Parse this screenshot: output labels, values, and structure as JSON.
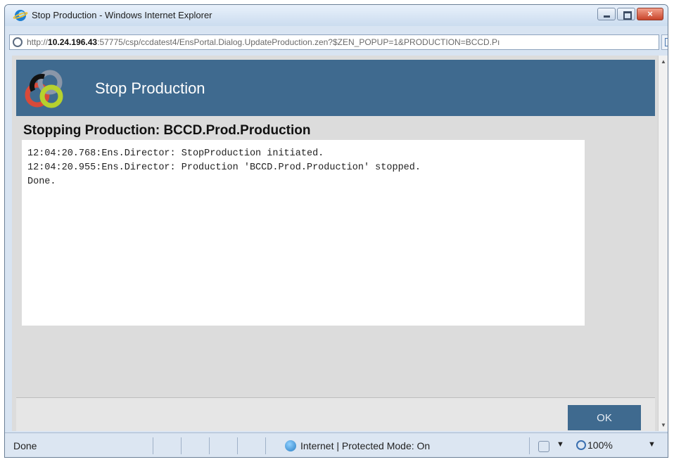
{
  "window": {
    "title": "Stop Production - Windows Internet Explorer",
    "url_prefix": "http://",
    "url_host": "10.24.196.43",
    "url_rest": ":57775/csp/ccdatest4/EnsPortal.Dialog.UpdateProduction.zen?$ZEN_POPUP=1&PRODUCTION=BCCD.Pı",
    "close_label": "×"
  },
  "dialog": {
    "banner_title": "Stop Production",
    "heading": "Stopping Production:  BCCD.Prod.Production",
    "log_lines": [
      "12:04:20.768:Ens.Director: StopProduction initiated.",
      "12:04:20.955:Ens.Director: Production 'BCCD.Prod.Production' stopped.",
      "Done."
    ],
    "ok_label": "OK"
  },
  "statusbar": {
    "status": "Done",
    "zone": "Internet | Protected Mode: On",
    "zoom": "100%",
    "dropdown_glyph": "▼"
  },
  "scroll": {
    "up": "▲",
    "down": "▼"
  },
  "colors": {
    "banner": "#3f6a8f",
    "ok_button": "#3f6a8f"
  }
}
